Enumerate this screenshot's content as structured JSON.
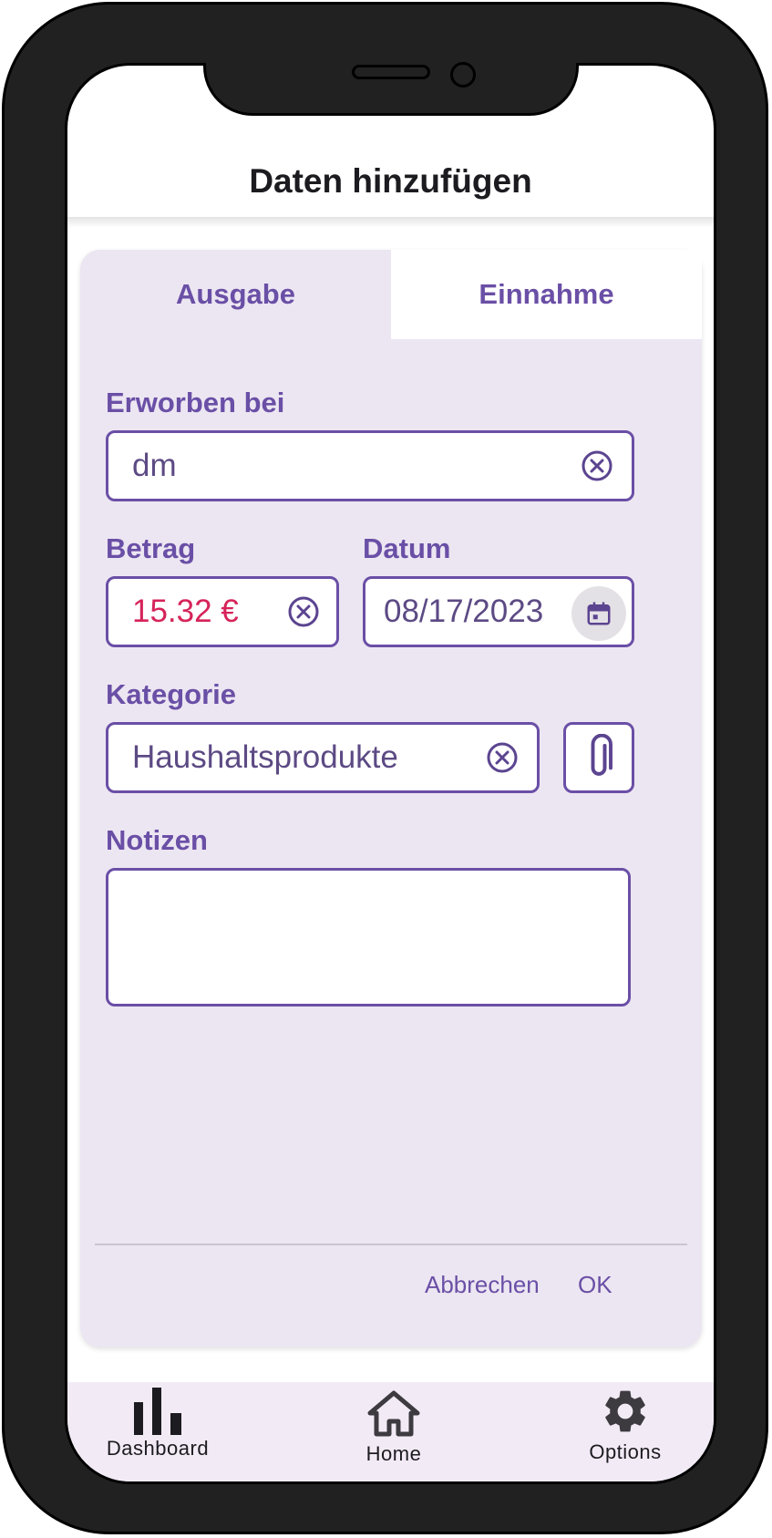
{
  "header": {
    "title": "Daten hinzufügen"
  },
  "tabs": [
    {
      "label": "Ausgabe",
      "active": true
    },
    {
      "label": "Einnahme",
      "active": false
    }
  ],
  "form": {
    "store": {
      "label": "Erworben bei",
      "value": "dm"
    },
    "amount": {
      "label": "Betrag",
      "value": "15.32 €"
    },
    "date": {
      "label": "Datum",
      "value": "08/17/2023"
    },
    "category": {
      "label": "Kategorie",
      "value": "Haushaltsprodukte"
    },
    "notes": {
      "label": "Notizen",
      "value": ""
    }
  },
  "actions": {
    "cancel": "Abbrechen",
    "ok": "OK"
  },
  "bottom_nav": {
    "items": [
      {
        "label": "Dashboard",
        "icon": "bar-chart-icon"
      },
      {
        "label": "Home",
        "icon": "home-icon"
      },
      {
        "label": "Options",
        "icon": "gear-icon"
      }
    ]
  },
  "colors": {
    "accent": "#6a4fa6",
    "amount_text": "#d6245a",
    "card_bg": "#ece6f2",
    "nav_bg": "#f2ebf6",
    "frame": "#212121"
  }
}
